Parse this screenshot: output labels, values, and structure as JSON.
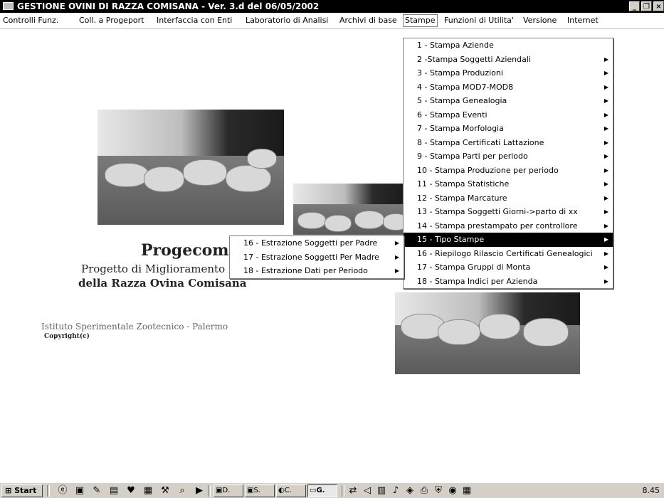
{
  "window": {
    "title": "GESTIONE OVINI DI RAZZA COMISANA - Ver. 3.d del 06/05/2002",
    "buttons": [
      "_",
      "и",
      "×"
    ]
  },
  "menubar": [
    "Controlli Funz.",
    "Coll. a Progeport",
    "Interfaccia con Enti",
    "Laboratorio di Analisi",
    "Archivi di base",
    "Stampe",
    "Funzioni di Utilita'",
    "Versione",
    "Internet"
  ],
  "brand": {
    "name": "Progecom",
    "line1": "Progetto di Miglioramento",
    "line2": "della Razza Ovina Comisana",
    "institute": "Istituto Sperimentale Zootecnico - Palermo",
    "copyright": "Copyright(c)"
  },
  "stampe_menu": [
    {
      "label": "1 - Stampa Aziende",
      "submenu": false
    },
    {
      "label": "2 -Stampa Soggetti Aziendali",
      "submenu": true
    },
    {
      "label": "3 - Stampa Produzioni",
      "submenu": true
    },
    {
      "label": "4 - Stampa MOD7-MOD8",
      "submenu": true
    },
    {
      "label": "5 - Stampa Genealogia",
      "submenu": true
    },
    {
      "label": "6 - Stampa Eventi",
      "submenu": true
    },
    {
      "label": "7 - Stampa Morfologia",
      "submenu": true
    },
    {
      "label": "8 - Stampa Certificati  Lattazione",
      "submenu": true
    },
    {
      "label": "9 - Stampa Parti per periodo",
      "submenu": true
    },
    {
      "label": "10 - Stampa Produzione per periodo",
      "submenu": true
    },
    {
      "label": "11 - Stampa Statistiche",
      "submenu": true
    },
    {
      "label": "12 - Stampa Marcature",
      "submenu": true
    },
    {
      "label": "13 - Stampa Soggetti Giorni->parto di xx",
      "submenu": true
    },
    {
      "label": "14 - Stampa prestampato per controllore",
      "submenu": true
    },
    {
      "label": "15 - Tipo Stampe",
      "submenu": true,
      "highlighted": true
    },
    {
      "label": "16 - Riepilogo Rilascio Certificati Genealogici",
      "submenu": true
    },
    {
      "label": "17 - Stampa Gruppi di Monta",
      "submenu": true
    },
    {
      "label": "18 - Stampa Indici per Azienda",
      "submenu": true
    }
  ],
  "submenu_tipo_stampe": [
    {
      "label": "16 - Estrazione Soggetti per Padre"
    },
    {
      "label": "17 - Estrazione Soggetti Per Madre"
    },
    {
      "label": "18 - Estrazione Dati per Periodo"
    }
  ],
  "taskbar": {
    "start": "Start",
    "tasks": [
      "D.",
      "S.",
      "C.",
      "G."
    ],
    "clock": "8.45"
  },
  "colors": {
    "highlight": "#000000",
    "titlebar": "#000000",
    "menu_border": "#808080"
  }
}
